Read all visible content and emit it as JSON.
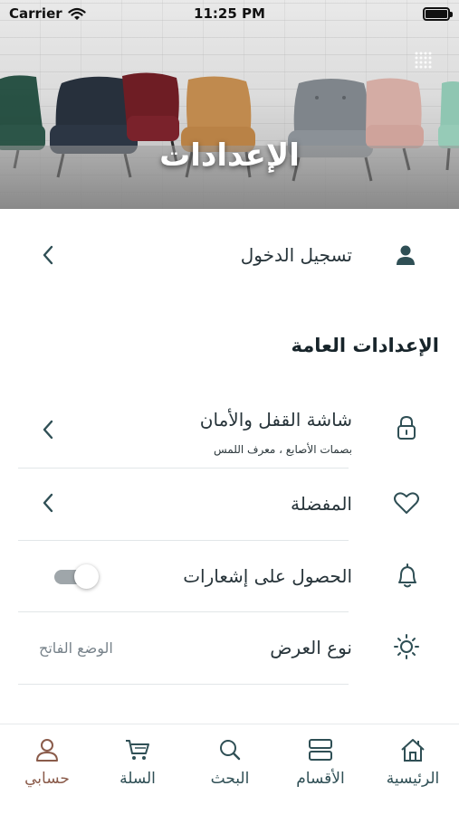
{
  "status_bar": {
    "carrier": "Carrier",
    "time": "11:25 PM"
  },
  "header": {
    "title": "الإعدادات"
  },
  "login": {
    "label": "تسجيل الدخول"
  },
  "general": {
    "title": "الإعدادات العامة",
    "lock": {
      "label": "شاشة القفل والأمان",
      "subtitle": "بصمات الأصابع ، معرف اللمس"
    },
    "favorites": {
      "label": "المفضلة"
    },
    "notifications": {
      "label": "الحصول على إشعارات",
      "enabled": true
    },
    "display": {
      "label": "نوع العرض",
      "value": "الوضع الفاتح"
    }
  },
  "tabs": [
    {
      "label": "الرئيسية",
      "icon": "home-icon"
    },
    {
      "label": "الأقسام",
      "icon": "categories-icon"
    },
    {
      "label": "البحث",
      "icon": "search-icon"
    },
    {
      "label": "السلة",
      "icon": "cart-icon"
    },
    {
      "label": "حسابي",
      "icon": "account-icon",
      "active": true
    }
  ],
  "colors": {
    "accent": "#8a5b4a",
    "icon": "#2f4f55",
    "text": "#27343a"
  }
}
